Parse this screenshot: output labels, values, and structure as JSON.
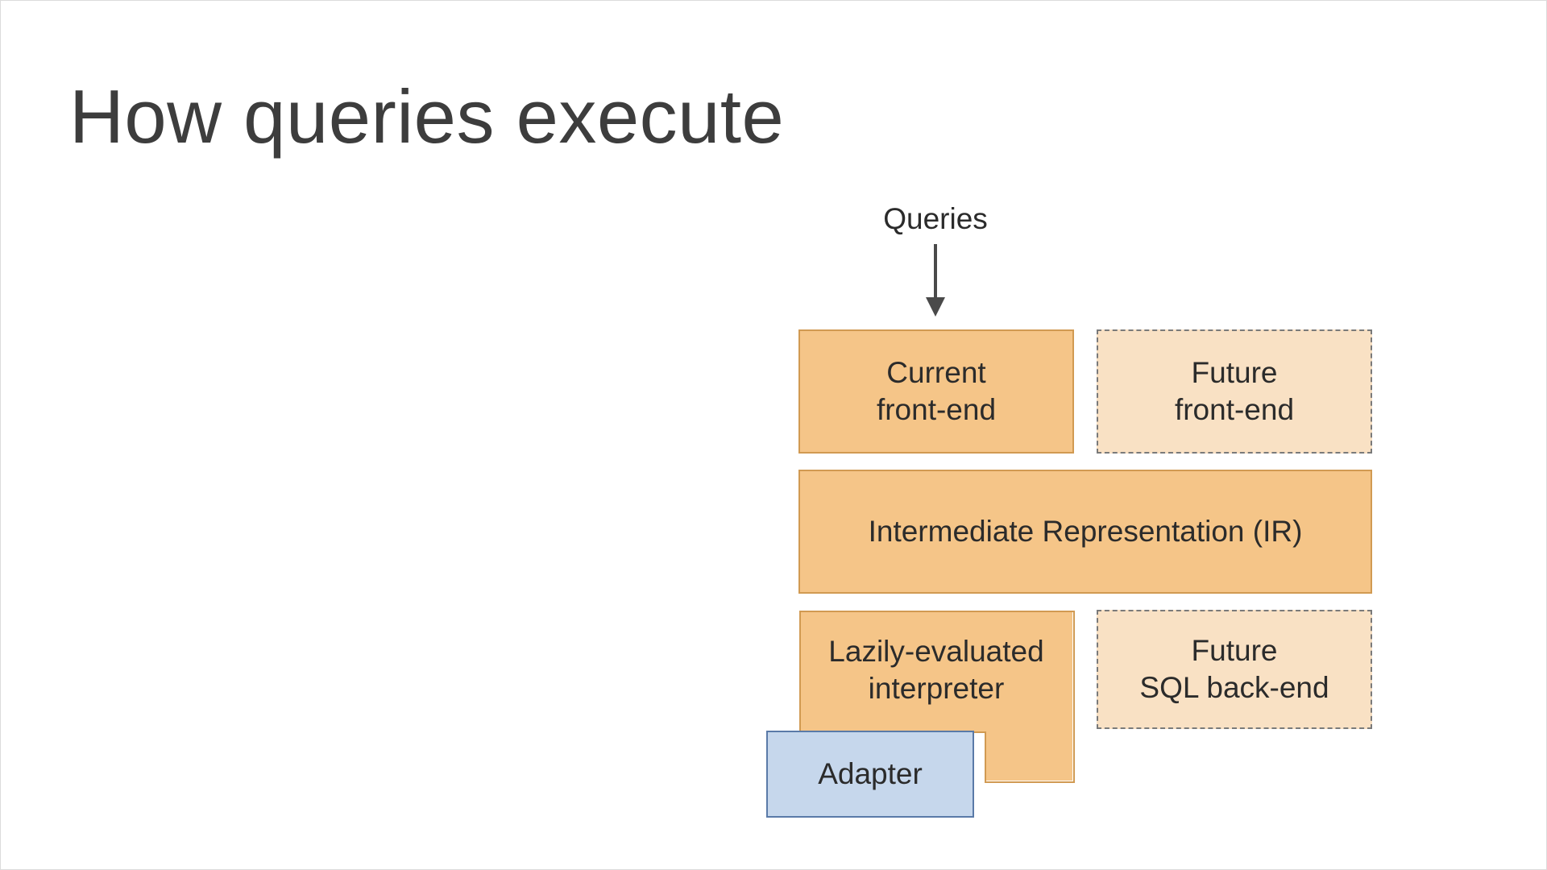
{
  "title": "How queries execute",
  "labels": {
    "queries": "Queries"
  },
  "boxes": {
    "current_frontend": "Current\nfront-end",
    "future_frontend": "Future\nfront-end",
    "ir": "Intermediate Representation (IR)",
    "interpreter": "Lazily-evaluated\ninterpreter",
    "future_sql": "Future\nSQL back-end",
    "adapter": "Adapter"
  },
  "colors": {
    "solid_orange_fill": "#f5c588",
    "solid_orange_border": "#d19a52",
    "dashed_orange_fill": "#f9e1c4",
    "dashed_border": "#7a7a7a",
    "blue_fill": "#c6d7ec",
    "blue_border": "#5a7aa8",
    "arrow": "#4a4a4a"
  },
  "layout_note": "architecture diagram on right half of slide; title upper-left"
}
